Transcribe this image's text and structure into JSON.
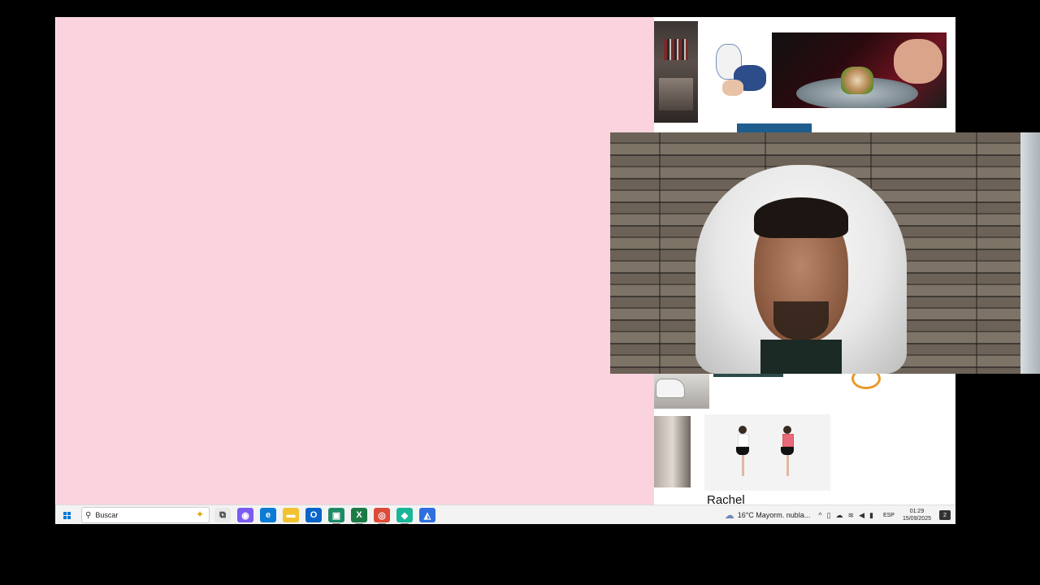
{
  "right_panel": {
    "name_label": "Rachel"
  },
  "taskbar": {
    "search_placeholder": "Buscar",
    "apps": [
      {
        "name": "task-view",
        "glyph": "⧉",
        "color": "#e9e9e9"
      },
      {
        "name": "copilot",
        "glyph": "◉",
        "color": "#7b5cf0"
      },
      {
        "name": "edge",
        "glyph": "e",
        "color": "#0b7bd6"
      },
      {
        "name": "file-explorer",
        "glyph": "▬",
        "color": "#f2c230"
      },
      {
        "name": "outlook",
        "glyph": "O",
        "color": "#0a64c9"
      },
      {
        "name": "photos",
        "glyph": "▣",
        "color": "#1f8a6a"
      },
      {
        "name": "excel",
        "glyph": "X",
        "color": "#1d7a45"
      },
      {
        "name": "chrome",
        "glyph": "◎",
        "color": "#dd4b39"
      },
      {
        "name": "teams-chat",
        "glyph": "◆",
        "color": "#1bb597"
      },
      {
        "name": "store",
        "glyph": "◭",
        "color": "#2f6fe0"
      }
    ],
    "weather_text": "16°C  Mayorm. nubla...",
    "language": "ESP",
    "time": "01:29",
    "date": "15/09/2025",
    "notification_count": "2"
  }
}
